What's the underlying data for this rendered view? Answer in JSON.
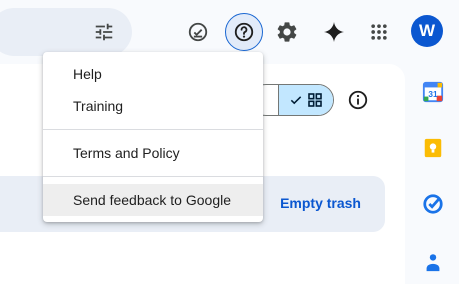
{
  "header": {
    "avatar_letter": "W",
    "icons": {
      "filter": "tune-icon",
      "ready_offline": "check-circle-icon",
      "help": "help-icon",
      "settings": "gear-icon",
      "gemini": "sparkle-icon",
      "apps": "apps-grid-icon"
    }
  },
  "help_menu": {
    "items": [
      {
        "label": "Help"
      },
      {
        "label": "Training"
      },
      {
        "label": "Terms and Policy"
      },
      {
        "label": "Send feedback to Google"
      }
    ]
  },
  "toolbar": {
    "view_toggle_icons": [
      "check-icon",
      "grid-view-icon"
    ],
    "info_icon": "info-icon"
  },
  "trash_banner": {
    "empty_trash_label": "Empty trash"
  },
  "side_panel": {
    "apps": [
      "calendar-icon",
      "keep-icon",
      "tasks-icon",
      "contacts-icon"
    ],
    "calendar_day": "31"
  },
  "colors": {
    "accent": "#0b57d0",
    "selected_toggle": "#c2e7ff",
    "banner": "#e9eef6"
  }
}
